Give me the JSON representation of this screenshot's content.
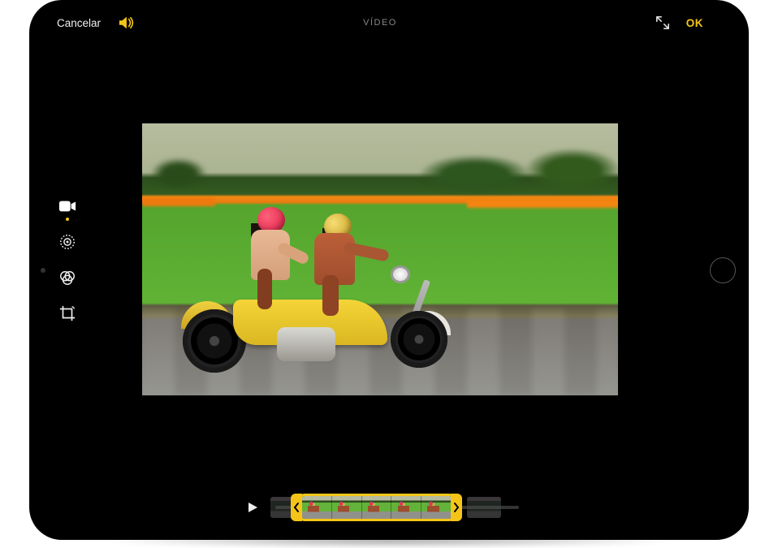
{
  "header": {
    "cancel_label": "Cancelar",
    "title_label": "VÍDEO",
    "done_label": "OK",
    "accent_color": "#f4c518"
  },
  "tools": {
    "video_label": "video-tool",
    "adjust_label": "adjust-tool",
    "filters_label": "filters-tool",
    "crop_label": "crop-tool",
    "active": "video"
  },
  "timeline": {
    "play_label": "play",
    "thumb_count": 5,
    "trim_start_index": 1,
    "trim_end_index": 5
  },
  "icons": {
    "volume": "volume-on",
    "fullscreen": "expand"
  }
}
